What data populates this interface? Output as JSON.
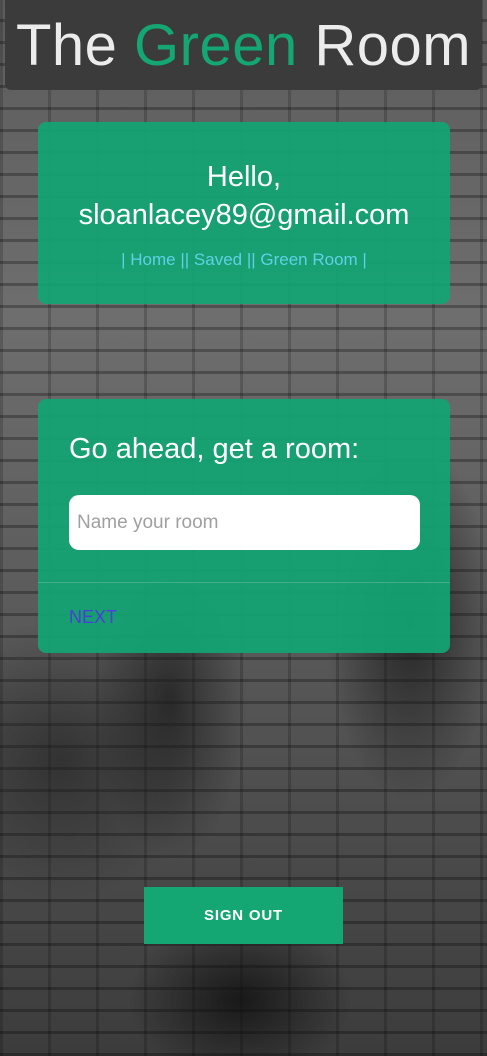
{
  "header": {
    "title_part1": "The ",
    "title_accent": "Green",
    "title_part2": " Room"
  },
  "greeting": {
    "line1": "Hello,",
    "email": "sloanlacey89@gmail.com"
  },
  "nav": {
    "home": "| Home |",
    "saved": "| Saved |",
    "green_room": "| Green Room |"
  },
  "room_form": {
    "title": "Go ahead, get a room:",
    "input_placeholder": "Name your room",
    "input_value": "",
    "next_label": "NEXT"
  },
  "signout_label": "SIGN OUT",
  "colors": {
    "accent": "#14a673",
    "link": "#5fd1e6",
    "next_link": "#4b3dd8"
  }
}
